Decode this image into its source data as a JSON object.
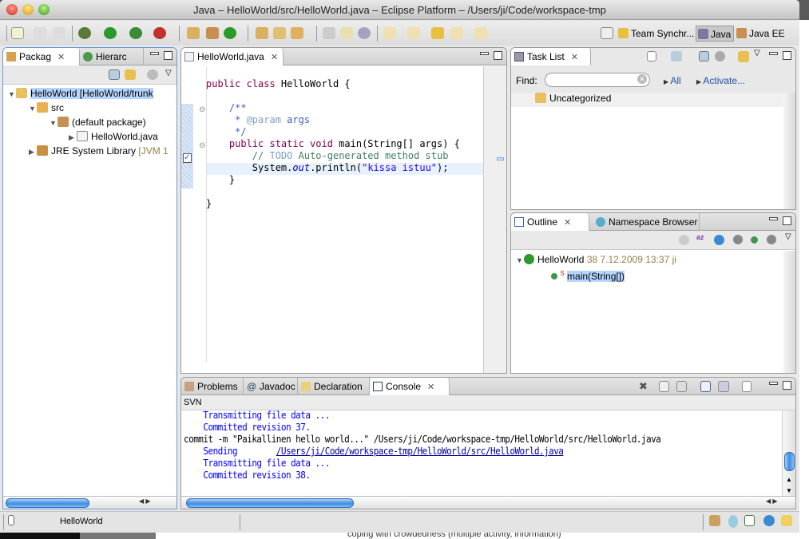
{
  "window": {
    "title": "Java – HelloWorld/src/HelloWorld.java – Eclipse Platform – /Users/ji/Code/workspace-tmp"
  },
  "perspectives": [
    {
      "label": "Team Synchr..."
    },
    {
      "label": "Java"
    },
    {
      "label": "Java EE"
    }
  ],
  "package_explorer": {
    "tabs": [
      {
        "label": "Packag"
      },
      {
        "label": "Hierarc"
      }
    ],
    "tree": [
      {
        "label": "HelloWorld [HelloWorld/trunk",
        "expanded": true
      },
      {
        "label": "src",
        "expanded": true
      },
      {
        "label": "(default package)",
        "expanded": true
      },
      {
        "label": "HelloWorld.java",
        "expanded": false
      },
      {
        "label": "JRE System Library",
        "suffix": "[JVM 1",
        "expanded": false
      }
    ]
  },
  "editor": {
    "tab": "HelloWorld.java",
    "lines": {
      "l1a": "public class ",
      "l1b": "HelloWorld {",
      "l3": "    /**",
      "l4a": "     * ",
      "l4b": "@param",
      "l4c": " args",
      "l5": "     */",
      "l6a": "    public static void ",
      "l6b": "main(String[] args) {",
      "l7a": "        // ",
      "l7b": "TODO",
      "l7c": " Auto-generated method stub",
      "l8a": "        System.",
      "l8b": "out",
      "l8c": ".println(",
      "l8d": "\"kissa istuu\"",
      "l8e": ");",
      "l9": "    }",
      "l11": "}"
    }
  },
  "task_list": {
    "tab": "Task List",
    "find_label": "Find:",
    "find_value": "",
    "all_label": "All",
    "activate_label": "Activate...",
    "items": [
      "Uncategorized"
    ]
  },
  "outline": {
    "tabs": [
      {
        "label": "Outline"
      },
      {
        "label": "Namespace Browser"
      }
    ],
    "class_name": "HelloWorld",
    "class_meta": "38  7.12.2009 13:37  ji",
    "method": "main(String[])",
    "method_modifier": "S"
  },
  "console": {
    "tabs": [
      {
        "label": "Problems"
      },
      {
        "label": "Javadoc"
      },
      {
        "label": "Declaration"
      },
      {
        "label": "Console"
      }
    ],
    "header": "SVN",
    "lines": [
      "    Transmitting file data ...",
      "    Committed revision 37.",
      "commit -m \"Paikallinen hello world...\" /Users/ji/Code/workspace-tmp/HelloWorld/src/HelloWorld.java",
      "    Sending        ",
      "    Transmitting file data ...",
      "    Committed revision 38."
    ],
    "sending_link": "/Users/ji/Code/workspace-tmp/HelloWorld/src/HelloWorld.java"
  },
  "status": {
    "selection": "HelloWorld"
  },
  "background": {
    "text": "coping with crowdedness (multiple activity, information)"
  },
  "colors": {
    "keyword": "#7f0055",
    "javadoc": "#3f5fbf",
    "comment": "#3f7f5f",
    "string": "#2a00ff",
    "selection": "#b5d5ff"
  }
}
